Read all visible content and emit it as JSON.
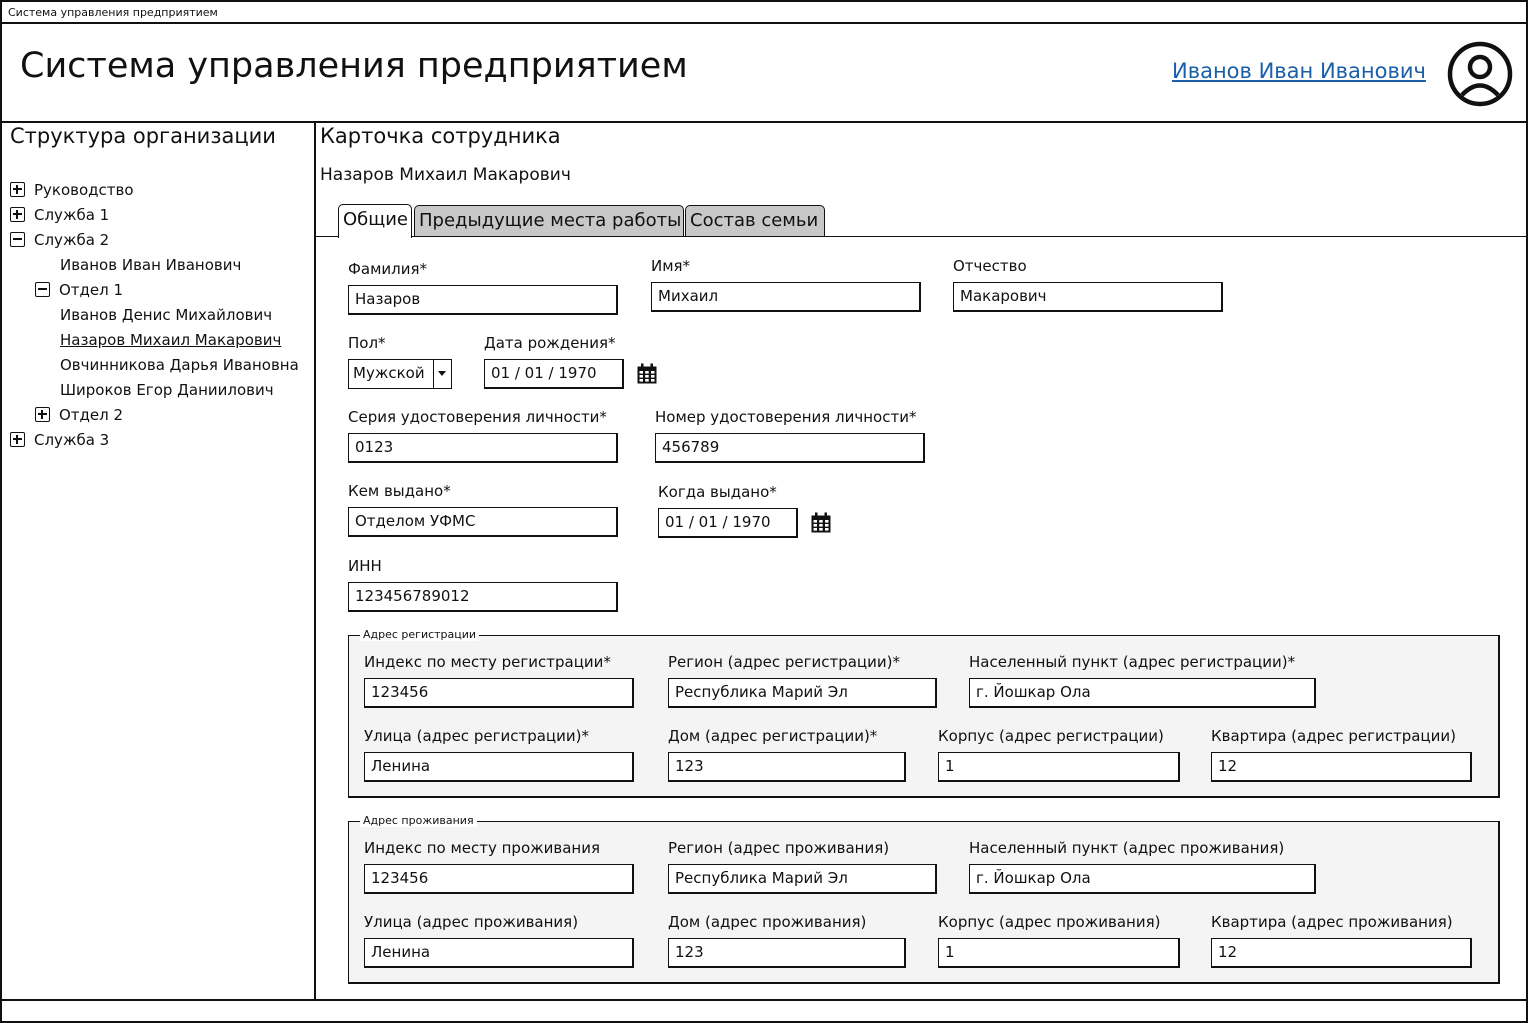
{
  "window": {
    "title": "Система управления предприятием"
  },
  "header": {
    "app_title": "Система управления предприятием",
    "user_name": "Иванов Иван Иванович"
  },
  "sidebar": {
    "title": "Структура организации",
    "tree": [
      {
        "label": "Руководство",
        "toggle": "plus"
      },
      {
        "label": "Служба 1",
        "toggle": "plus"
      },
      {
        "label": "Служба 2",
        "toggle": "minus"
      },
      {
        "label": "Иванов Иван Иванович",
        "toggle": "none"
      },
      {
        "label": "Отдел 1",
        "toggle": "minus"
      },
      {
        "label": "Иванов Денис Михайлович",
        "toggle": "none"
      },
      {
        "label": "Назаров Михаил Макарович",
        "toggle": "none",
        "selected": true
      },
      {
        "label": "Овчинникова Дарья Ивановна",
        "toggle": "none"
      },
      {
        "label": "Широков Егор Даниилович",
        "toggle": "none"
      },
      {
        "label": "Отдел 2",
        "toggle": "plus"
      },
      {
        "label": "Служба 3",
        "toggle": "plus"
      }
    ]
  },
  "card": {
    "title": "Карточка сотрудника",
    "employee_name": "Назаров Михаил Макарович",
    "tabs": [
      {
        "label": "Общие",
        "active": true
      },
      {
        "label": "Предыдущие места работы",
        "active": false
      },
      {
        "label": "Состав семьи",
        "active": false
      }
    ]
  },
  "form": {
    "last_name": {
      "label": "Фамилия*",
      "value": "Назаров"
    },
    "first_name": {
      "label": "Имя*",
      "value": "Михаил"
    },
    "patronymic": {
      "label": "Отчество",
      "value": "Макарович"
    },
    "gender": {
      "label": "Пол*",
      "value": "Мужской"
    },
    "birth_date": {
      "label": "Дата рождения*",
      "value": "01  / 01 / 1970"
    },
    "id_series": {
      "label": "Серия удостоверения личности*",
      "value": "0123"
    },
    "id_number": {
      "label": "Номер удостоверения личности*",
      "value": "456789"
    },
    "issued_by": {
      "label": "Кем выдано*",
      "value": "Отделом УФМС"
    },
    "issued_date": {
      "label": "Когда выдано*",
      "value": "01  / 01 / 1970"
    },
    "inn": {
      "label": "ИНН",
      "value": "123456789012"
    }
  },
  "reg_address": {
    "legend": "Адрес регистрации",
    "index": {
      "label": "Индекс по месту регистрации*",
      "value": "123456"
    },
    "region": {
      "label": "Регион (адрес регистрации)*",
      "value": "Республика Марий Эл"
    },
    "locality": {
      "label": "Населенный пункт (адрес регистрации)*",
      "value": "г. Йошкар Ола"
    },
    "street": {
      "label": "Улица (адрес регистрации)*",
      "value": "Ленина"
    },
    "house": {
      "label": "Дом (адрес регистрации)*",
      "value": "123"
    },
    "building": {
      "label": "Корпус (адрес регистрации)",
      "value": "1"
    },
    "apartment": {
      "label": "Квартира (адрес регистрации)",
      "value": "12"
    }
  },
  "live_address": {
    "legend": "Адрес проживания",
    "index": {
      "label": "Индекс по месту проживания",
      "value": "123456"
    },
    "region": {
      "label": "Регион (адрес проживания)",
      "value": "Республика Марий Эл"
    },
    "locality": {
      "label": "Населенный пункт (адрес проживания)",
      "value": "г. Йошкар Ола"
    },
    "street": {
      "label": "Улица (адрес проживания)",
      "value": "Ленина"
    },
    "house": {
      "label": "Дом (адрес проживания)",
      "value": "123"
    },
    "building": {
      "label": "Корпус (адрес проживания)",
      "value": "1"
    },
    "apartment": {
      "label": "Квартира (адрес проживания)",
      "value": "12"
    }
  },
  "colors": {
    "link": "#1a5fa8",
    "inactive_tab": "#c8c8c8",
    "group_bg": "#f4f4f4"
  },
  "icons": {
    "avatar": "user-circle-icon",
    "calendar": "calendar-icon",
    "dropdown": "chevron-down-icon"
  }
}
